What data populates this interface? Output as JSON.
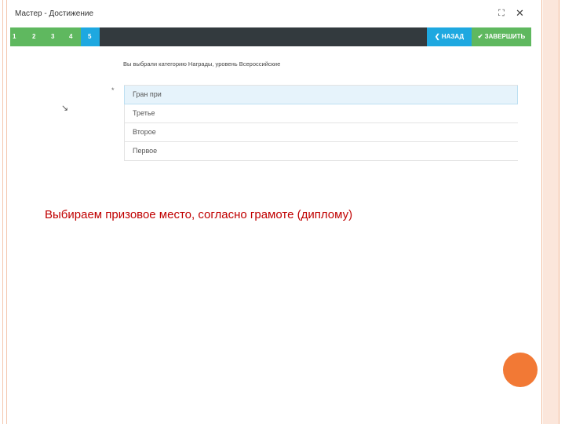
{
  "window": {
    "title": "Мастер - Достижение",
    "restore_icon": "⛶",
    "close_icon": "✕"
  },
  "wizard": {
    "steps": [
      "1",
      "2",
      "3",
      "4",
      "5"
    ],
    "current_step": 5,
    "back_label": "❮ НАЗАД",
    "finish_label": "✔ ЗАВЕРШИТЬ"
  },
  "selection_info": "Вы выбрали категорию Награды, уровень Всероссийские",
  "required_mark": "*",
  "side_arrow": "↘",
  "options": [
    {
      "label": "Гран при",
      "selected": true
    },
    {
      "label": "Третье",
      "selected": false
    },
    {
      "label": "Второе",
      "selected": false
    },
    {
      "label": "Первое",
      "selected": false
    }
  ],
  "caption": "Выбираем призовое место, согласно грамоте (диплому)",
  "colors": {
    "step_done": "#5fb85f",
    "step_active": "#1ea8e0",
    "step_bar": "#333a3e",
    "caption": "#c00000",
    "accent_dot": "#f27935"
  }
}
